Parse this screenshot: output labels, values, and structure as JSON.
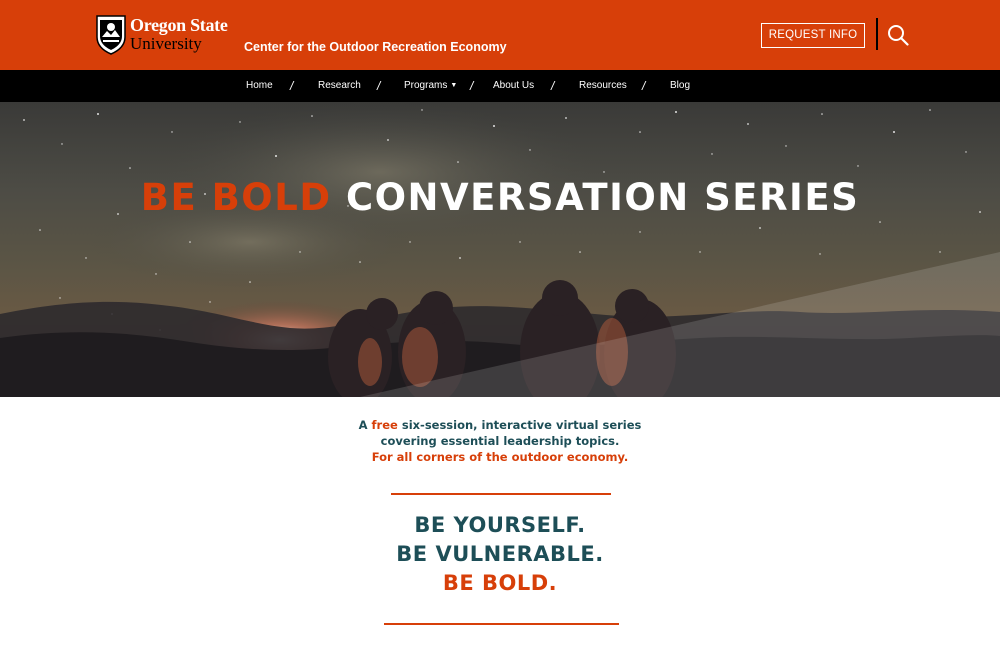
{
  "header": {
    "logo_line1": "Oregon State",
    "logo_line2": "University",
    "site_name": "Center for the Outdoor Recreation Economy",
    "request_info_label": "REQUEST INFO",
    "search_icon": "search-icon",
    "brand_color": "#d73f09"
  },
  "nav": {
    "items": [
      {
        "label": "Home"
      },
      {
        "label": "Research"
      },
      {
        "label": "Programs",
        "has_dropdown": true
      },
      {
        "label": "About Us"
      },
      {
        "label": "Resources"
      },
      {
        "label": "Blog"
      }
    ],
    "separator": "/"
  },
  "hero": {
    "title_accent": "BE BOLD",
    "title_rest": "CONVERSATION SERIES"
  },
  "intro": {
    "line1_a": "A",
    "line1_free": "free",
    "line1_b": "six-session, interactive virtual series",
    "line2": "covering essential leadership topics.",
    "line3": "For all corners of the outdoor economy."
  },
  "motto": {
    "line1": "BE YOURSELF.",
    "line2": "BE VULNERABLE.",
    "line3": "BE BOLD."
  },
  "colors": {
    "orange": "#d73f09",
    "teal": "#1d4e57",
    "nav_bg": "#000000"
  }
}
